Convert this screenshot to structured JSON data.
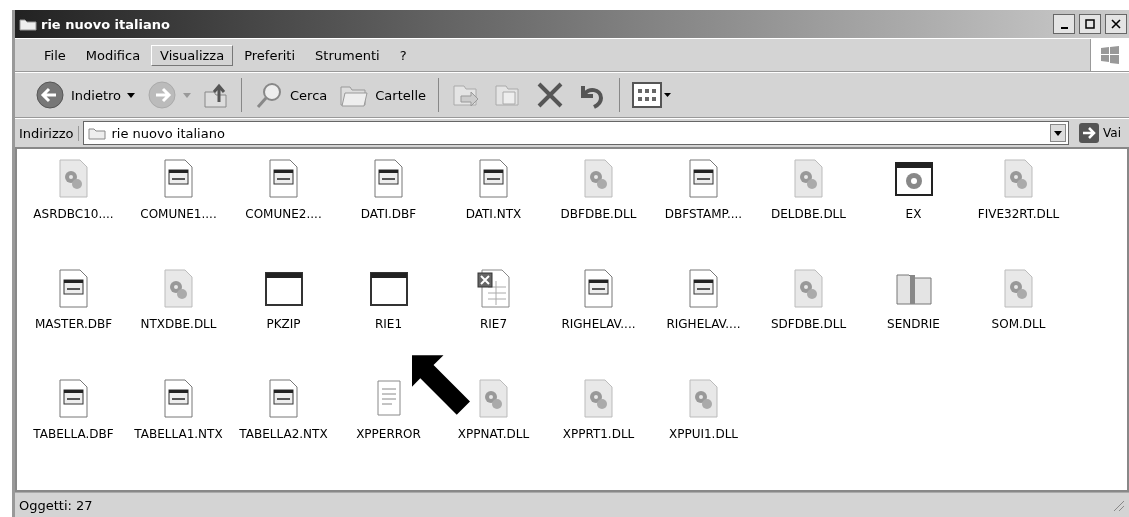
{
  "window": {
    "title": "rie nuovo italiano"
  },
  "menu": [
    {
      "label": "File",
      "selected": false
    },
    {
      "label": "Modifica",
      "selected": false
    },
    {
      "label": "Visualizza",
      "selected": true
    },
    {
      "label": "Preferiti",
      "selected": false
    },
    {
      "label": "Strumenti",
      "selected": false
    },
    {
      "label": "?",
      "selected": false
    }
  ],
  "toolbar": {
    "back": "Indietro",
    "search": "Cerca",
    "folders": "Cartelle"
  },
  "address": {
    "label": "Indirizzo",
    "value": "rie nuovo italiano",
    "go": "Vai"
  },
  "files": [
    {
      "name": "ASRDBC10....",
      "kind": "dll"
    },
    {
      "name": "COMUNE1....",
      "kind": "doc"
    },
    {
      "name": "COMUNE2....",
      "kind": "doc"
    },
    {
      "name": "DATI.DBF",
      "kind": "doc"
    },
    {
      "name": "DATI.NTX",
      "kind": "doc"
    },
    {
      "name": "DBFDBE.DLL",
      "kind": "dll"
    },
    {
      "name": "DBFSTAMP....",
      "kind": "doc"
    },
    {
      "name": "DELDBE.DLL",
      "kind": "dll"
    },
    {
      "name": "EX",
      "kind": "setup"
    },
    {
      "name": "FIVE32RT.DLL",
      "kind": "dll"
    },
    {
      "name": "MASTER.DBF",
      "kind": "doc"
    },
    {
      "name": "NTXDBE.DLL",
      "kind": "dll"
    },
    {
      "name": "PKZIP",
      "kind": "exe"
    },
    {
      "name": "RIE1",
      "kind": "exe"
    },
    {
      "name": "RIE7",
      "kind": "sheet"
    },
    {
      "name": "RIGHELAV....",
      "kind": "doc"
    },
    {
      "name": "RIGHELAV....",
      "kind": "doc"
    },
    {
      "name": "SDFDBE.DLL",
      "kind": "dll"
    },
    {
      "name": "SENDRIE",
      "kind": "zip"
    },
    {
      "name": "SOM.DLL",
      "kind": "dll"
    },
    {
      "name": "TABELLA.DBF",
      "kind": "doc"
    },
    {
      "name": "TABELLA1.NTX",
      "kind": "doc"
    },
    {
      "name": "TABELLA2.NTX",
      "kind": "doc"
    },
    {
      "name": "XPPERROR",
      "kind": "text"
    },
    {
      "name": "XPPNAT.DLL",
      "kind": "dll"
    },
    {
      "name": "XPPRT1.DLL",
      "kind": "dll"
    },
    {
      "name": "XPPUI1.DLL",
      "kind": "dll"
    }
  ],
  "status_bar": "Oggetti: 27"
}
